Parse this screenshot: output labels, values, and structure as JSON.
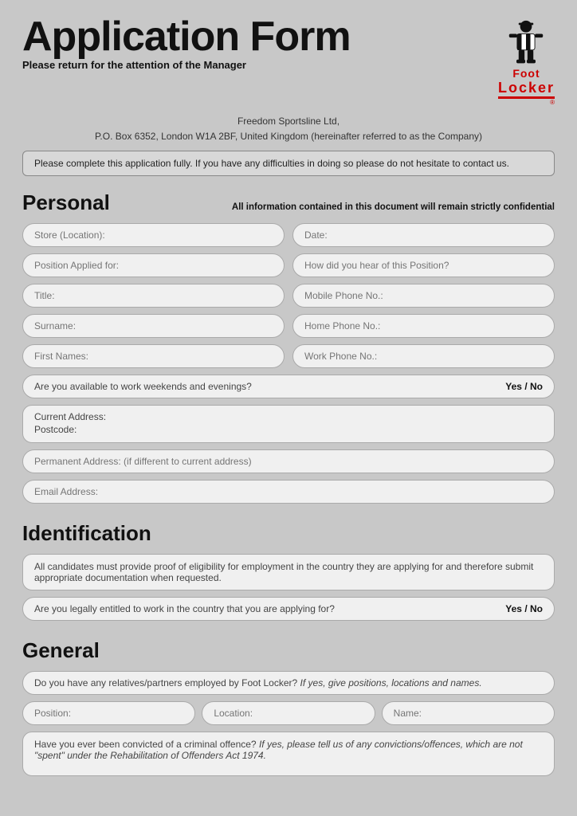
{
  "header": {
    "title": "Application Form",
    "subtitle": "Please return for the attention of the Manager",
    "logo": {
      "foot": "Foot",
      "locker": "Locker",
      "tm": "®"
    }
  },
  "company": {
    "line1": "Freedom Sportsline Ltd,",
    "line2": "P.O. Box 6352, London W1A 2BF, United Kingdom (hereinafter referred to as the Company)"
  },
  "notice": "Please complete this application fully. If you have any difficulties in doing so please do not hesitate to contact us.",
  "personal": {
    "section_title": "Personal",
    "confidential_note": "All information contained in this document will remain strictly confidential",
    "fields": {
      "store_location": "Store (Location):",
      "date": "Date:",
      "position_applied": "Position Applied for:",
      "how_hear": "How did you hear of this Position?",
      "title": "Title:",
      "mobile_phone": "Mobile Phone No.:",
      "surname": "Surname:",
      "home_phone": "Home Phone No.:",
      "first_names": "First Names:",
      "work_phone": "Work Phone No.:",
      "weekends": "Are you available to work weekends and evenings?",
      "weekends_yesno": "Yes / No",
      "current_address": "Current Address:",
      "postcode": "Postcode:",
      "permanent_address": "Permanent Address:",
      "permanent_address_note": "if different to current address",
      "email": "Email Address:"
    }
  },
  "identification": {
    "section_title": "Identification",
    "notice": "All candidates must provide proof of eligibility for employment in the country they are applying for and therefore submit appropriate documentation when requested.",
    "legally_entitled": "Are you legally entitled to work in the country that you are applying for?",
    "legally_entitled_yesno": "Yes / No"
  },
  "general": {
    "section_title": "General",
    "relatives_question": "Do you have any relatives/partners employed by Foot Locker?",
    "relatives_note": "If yes, give positions, locations and names.",
    "position_label": "Position:",
    "location_label": "Location:",
    "name_label": "Name:",
    "criminal_question": "Have you ever been convicted of a criminal offence?",
    "criminal_note": "If yes, please tell us of any convictions/offences, which are not \"spent\" under the Rehabilitation of Offenders Act 1974."
  }
}
